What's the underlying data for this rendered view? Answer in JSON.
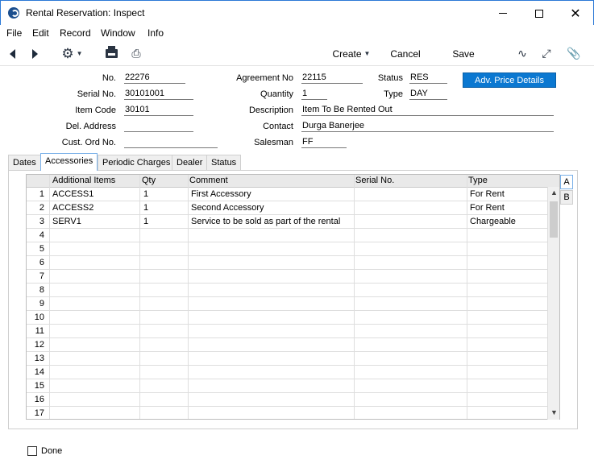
{
  "window": {
    "title": "Rental Reservation: Inspect",
    "close_glyph": "✕"
  },
  "menu": [
    "File",
    "Edit",
    "Record",
    "Window",
    "Info"
  ],
  "toolbar": {
    "create_label": "Create",
    "cancel_label": "Cancel",
    "save_label": "Save"
  },
  "header": {
    "no_label": "No.",
    "no_value": "22276",
    "serial_label": "Serial No.",
    "serial_value": "30101001",
    "item_code_label": "Item Code",
    "item_code_value": "30101",
    "del_address_label": "Del. Address",
    "del_address_value": "",
    "cust_ord_label": "Cust. Ord No.",
    "cust_ord_value": "",
    "agreement_label": "Agreement No",
    "agreement_value": "22115",
    "quantity_label": "Quantity",
    "quantity_value": "1",
    "description_label": "Description",
    "description_value": "Item To Be Rented Out",
    "contact_label": "Contact",
    "contact_value": "Durga Banerjee",
    "salesman_label": "Salesman",
    "salesman_value": "FF",
    "status_label": "Status",
    "status_value": "RES",
    "type_label": "Type",
    "type_value": "DAY",
    "adv_price_label": "Adv. Price Details"
  },
  "tabs": [
    "Dates",
    "Accessories",
    "Periodic Charges",
    "Dealer",
    "Status"
  ],
  "side_tabs": [
    "A",
    "B"
  ],
  "grid": {
    "columns": [
      "Additional Items",
      "Qty",
      "Comment",
      "Serial No.",
      "Type"
    ],
    "rows": [
      {
        "num": "1",
        "item": "ACCESS1",
        "qty": "1",
        "comment": "First Accessory",
        "serial": "",
        "type": "For Rent"
      },
      {
        "num": "2",
        "item": "ACCESS2",
        "qty": "1",
        "comment": "Second Accessory",
        "serial": "",
        "type": "For Rent"
      },
      {
        "num": "3",
        "item": "SERV1",
        "qty": "1",
        "comment": "Service to be sold as part of the rental",
        "serial": "",
        "type": "Chargeable"
      },
      {
        "num": "4"
      },
      {
        "num": "5"
      },
      {
        "num": "6"
      },
      {
        "num": "7"
      },
      {
        "num": "8"
      },
      {
        "num": "9"
      },
      {
        "num": "10"
      },
      {
        "num": "11"
      },
      {
        "num": "12"
      },
      {
        "num": "13"
      },
      {
        "num": "14"
      },
      {
        "num": "15"
      },
      {
        "num": "16"
      },
      {
        "num": "17"
      }
    ]
  },
  "footer": {
    "done_label": "Done"
  }
}
